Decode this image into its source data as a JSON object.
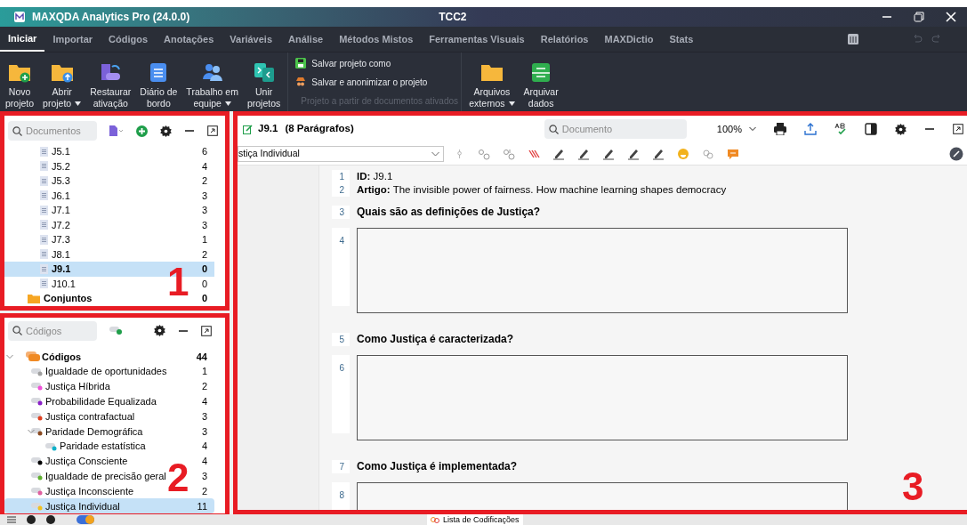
{
  "window": {
    "app_title": "MAXQDA Analytics Pro (24.0.0)",
    "project_title": "TCC2"
  },
  "ribbon_tabs": [
    {
      "label": "Iniciar",
      "selected": true
    },
    {
      "label": "Importar",
      "selected": false
    },
    {
      "label": "Códigos",
      "selected": false
    },
    {
      "label": "Anotações",
      "selected": false
    },
    {
      "label": "Variáveis",
      "selected": false
    },
    {
      "label": "Análise",
      "selected": false
    },
    {
      "label": "Métodos Mistos",
      "selected": false
    },
    {
      "label": "Ferramentas Visuais",
      "selected": false
    },
    {
      "label": "Relatórios",
      "selected": false
    },
    {
      "label": "MAXDictio",
      "selected": false
    },
    {
      "label": "Stats",
      "selected": false
    }
  ],
  "ribbon_buttons": [
    {
      "lines": [
        "Novo",
        "projeto"
      ],
      "has_menu": false
    },
    {
      "lines": [
        "Abrir",
        "projeto"
      ],
      "has_menu": true
    },
    {
      "lines": [
        "Restaurar",
        "ativação"
      ],
      "has_menu": false
    },
    {
      "lines": [
        "Diário de",
        "bordo"
      ],
      "has_menu": false
    },
    {
      "lines": [
        "Trabalho em",
        "equipe"
      ],
      "has_menu": true
    },
    {
      "lines": [
        "Unir",
        "projetos"
      ],
      "has_menu": false
    }
  ],
  "project_menu": [
    {
      "label": "Salvar projeto como",
      "disabled": false
    },
    {
      "label": "Salvar e anonimizar o projeto",
      "disabled": false
    },
    {
      "label": "Projeto a partir de documentos ativados",
      "disabled": true
    }
  ],
  "archive_buttons": [
    {
      "lines": [
        "Arquivos",
        "externos"
      ],
      "has_menu": true
    },
    {
      "lines": [
        "Arquivar",
        "dados"
      ],
      "has_menu": false
    }
  ],
  "documents_panel": {
    "search_placeholder": "Documentos",
    "annotation": "1",
    "items": [
      {
        "name": "J5.1",
        "count": "6",
        "selected": false
      },
      {
        "name": "J5.2",
        "count": "4",
        "selected": false
      },
      {
        "name": "J5.3",
        "count": "2",
        "selected": false
      },
      {
        "name": "J6.1",
        "count": "3",
        "selected": false
      },
      {
        "name": "J7.1",
        "count": "3",
        "selected": false
      },
      {
        "name": "J7.2",
        "count": "3",
        "selected": false
      },
      {
        "name": "J7.3",
        "count": "1",
        "selected": false
      },
      {
        "name": "J8.1",
        "count": "2",
        "selected": false
      },
      {
        "name": "J9.1",
        "count": "0",
        "selected": true
      },
      {
        "name": "J10.1",
        "count": "0",
        "selected": false
      }
    ],
    "sets": {
      "name": "Conjuntos",
      "count": "0"
    }
  },
  "codes_panel": {
    "search_placeholder": "Códigos",
    "annotation": "2",
    "root": {
      "name": "Códigos",
      "count": "44",
      "expanded": true
    },
    "codes": [
      {
        "name": "Igualdade de oportunidades",
        "count": "1",
        "color": "#a0a0a0",
        "selected": false
      },
      {
        "name": "Justiça Híbrida",
        "count": "2",
        "color": "#f050d8",
        "selected": false
      },
      {
        "name": "Probabilidade Equalizada",
        "count": "4",
        "color": "#8a20c8",
        "selected": false
      },
      {
        "name": "Justiça contrafactual",
        "count": "3",
        "color": "#e04020",
        "selected": false
      },
      {
        "name": "Paridade Demográfica",
        "count": "3",
        "color": "#8a4a20",
        "selected": false,
        "expanded": true,
        "children": [
          {
            "name": "Paridade estatística",
            "count": "4",
            "color": "#10b0c8",
            "selected": false
          }
        ]
      },
      {
        "name": "Justiça Consciente",
        "count": "4",
        "color": "#000000",
        "selected": false
      },
      {
        "name": "Igualdade de precisão geral",
        "count": "3",
        "color": "#60b030",
        "selected": false
      },
      {
        "name": "Justiça Inconsciente",
        "count": "2",
        "color": "#e060a0",
        "selected": false
      },
      {
        "name": "Justiça Individual",
        "count": "11",
        "color": "#f0c020",
        "selected": true
      }
    ]
  },
  "document_browser": {
    "title": "J9.1",
    "subtitle": "(8 Parágrafos)",
    "search_placeholder": "Documento",
    "zoom": "100%",
    "code_selector": "stiça Individual",
    "annotation": "3",
    "paragraphs": [
      {
        "number": "1",
        "kind": "text",
        "text": "**ID:** J9.1"
      },
      {
        "number": "2",
        "kind": "text",
        "text": "**Artigo:** The invisible power of fairness. How machine learning shapes democracy"
      },
      {
        "number": "3",
        "kind": "heading",
        "text": "Quais são as definições de Justiça?"
      },
      {
        "number": "4",
        "kind": "box"
      },
      {
        "number": "5",
        "kind": "heading",
        "text": "Como Justiça é caracterizada?"
      },
      {
        "number": "6",
        "kind": "box"
      },
      {
        "number": "7",
        "kind": "heading",
        "text": "Como Justiça é implementada?"
      },
      {
        "number": "8",
        "kind": "box"
      }
    ]
  },
  "status_bar": {
    "tab": "Lista de Codificações"
  }
}
